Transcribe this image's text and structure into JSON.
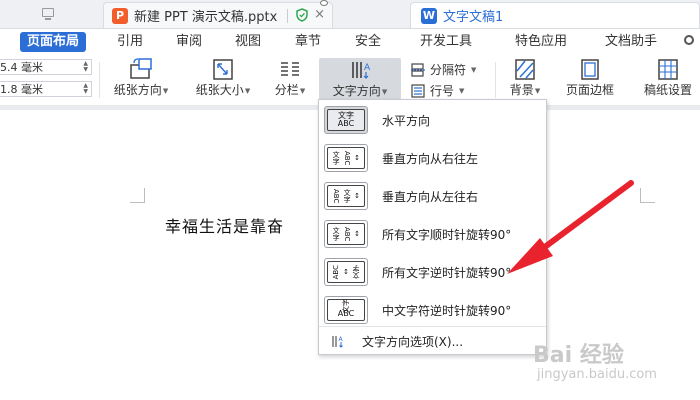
{
  "tabs": {
    "ppt": {
      "badge": "P",
      "title": "新建 PPT 演示文稿.pptx",
      "color": "#f25d2c"
    },
    "doc": {
      "badge": "W",
      "title": "文字文稿1",
      "color": "#2b6fd6"
    }
  },
  "menu": [
    "页面布局",
    "引用",
    "审阅",
    "视图",
    "章节",
    "安全",
    "开发工具",
    "特色应用",
    "文档助手"
  ],
  "ribbon": {
    "margin_top": "5.4 毫米",
    "margin_bottom": "1.8 毫米",
    "paper_orientation": "纸张方向",
    "paper_size": "纸张大小",
    "columns": "分栏",
    "text_direction": "文字方向",
    "breaks": "分隔符",
    "line_numbers": "行号",
    "background": "背景",
    "page_border": "页面边框",
    "paper_settings": "稿纸设置"
  },
  "document": {
    "text": "幸福生活是靠奋"
  },
  "dropdown": {
    "items": [
      {
        "label": "水平方向",
        "icon": "horizontal-text-icon"
      },
      {
        "label": "垂直方向从右往左",
        "icon": "vertical-rtl-icon"
      },
      {
        "label": "垂直方向从左往右",
        "icon": "vertical-ltr-icon"
      },
      {
        "label": "所有文字顺时针旋转90°",
        "icon": "rotate-cw-icon"
      },
      {
        "label": "所有文字逆时针旋转90°",
        "icon": "rotate-ccw-icon"
      },
      {
        "label": "中文字符逆时针旋转90°",
        "icon": "cjk-rotate-ccw-icon"
      }
    ],
    "footer": "文字方向选项(X)...",
    "icon_glyphs": {
      "h_top": "文字",
      "h_bot": "ABC",
      "abc": "ABC",
      "wen": "文字"
    }
  },
  "watermark": {
    "brand": "Bai 经验",
    "url": "jingyan.baidu.com"
  }
}
